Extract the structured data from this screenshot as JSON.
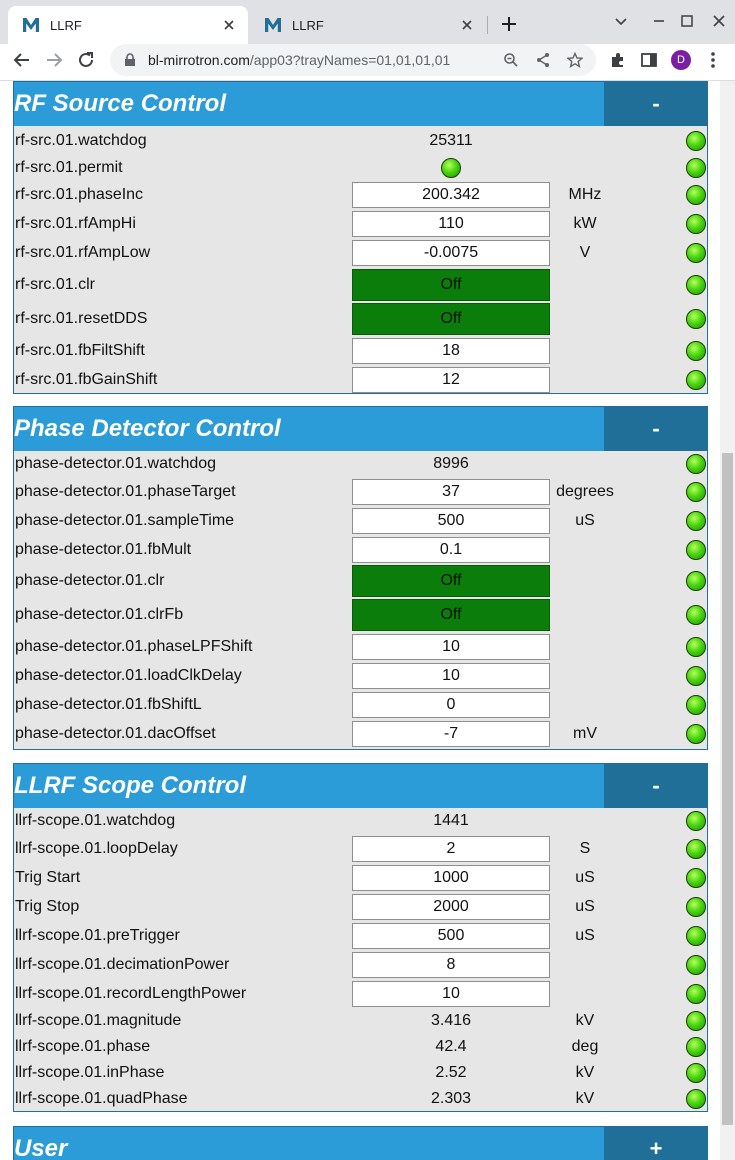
{
  "browser": {
    "tabs": [
      {
        "title": "LLRF",
        "favicon": "M"
      },
      {
        "title": "LLRF",
        "favicon": "M"
      }
    ],
    "url_host": "bl-mirrotron.com",
    "url_path": "/app03?trayNames=01,01,01,01",
    "profile_initial": "D",
    "favicon_color": "#1f6f98",
    "profile_color": "#7b1fa2"
  },
  "panels": {
    "rf": {
      "title": "RF Source Control",
      "toggle": "-",
      "rows": {
        "watchdog": {
          "label": "rf-src.01.watchdog",
          "value": "25311"
        },
        "permit": {
          "label": "rf-src.01.permit"
        },
        "phaseInc": {
          "label": "rf-src.01.phaseInc",
          "value": "200.342",
          "unit": "MHz"
        },
        "rfAmpHi": {
          "label": "rf-src.01.rfAmpHi",
          "value": "110",
          "unit": "kW"
        },
        "rfAmpLow": {
          "label": "rf-src.01.rfAmpLow",
          "value": "-0.0075",
          "unit": "V"
        },
        "clr": {
          "label": "rf-src.01.clr",
          "value": "Off"
        },
        "resetDDS": {
          "label": "rf-src.01.resetDDS",
          "value": "Off"
        },
        "fbFiltShift": {
          "label": "rf-src.01.fbFiltShift",
          "value": "18"
        },
        "fbGainShift": {
          "label": "rf-src.01.fbGainShift",
          "value": "12"
        }
      }
    },
    "pd": {
      "title": "Phase Detector Control",
      "toggle": "-",
      "rows": {
        "watchdog": {
          "label": "phase-detector.01.watchdog",
          "value": "8996"
        },
        "phaseTarget": {
          "label": "phase-detector.01.phaseTarget",
          "value": "37",
          "unit": "degrees"
        },
        "sampleTime": {
          "label": "phase-detector.01.sampleTime",
          "value": "500",
          "unit": "uS"
        },
        "fbMult": {
          "label": "phase-detector.01.fbMult",
          "value": "0.1"
        },
        "clr": {
          "label": "phase-detector.01.clr",
          "value": "Off"
        },
        "clrFb": {
          "label": "phase-detector.01.clrFb",
          "value": "Off"
        },
        "phaseLPFShift": {
          "label": "phase-detector.01.phaseLPFShift",
          "value": "10"
        },
        "loadClkDelay": {
          "label": "phase-detector.01.loadClkDelay",
          "value": "10"
        },
        "fbShiftL": {
          "label": "phase-detector.01.fbShiftL",
          "value": "0"
        },
        "dacOffset": {
          "label": "phase-detector.01.dacOffset",
          "value": "-7",
          "unit": "mV"
        }
      }
    },
    "scope": {
      "title": "LLRF Scope Control",
      "toggle": "-",
      "rows": {
        "watchdog": {
          "label": "llrf-scope.01.watchdog",
          "value": "1441"
        },
        "loopDelay": {
          "label": "llrf-scope.01.loopDelay",
          "value": "2",
          "unit": "S"
        },
        "trigStart": {
          "label": "Trig Start",
          "value": "1000",
          "unit": "uS"
        },
        "trigStop": {
          "label": "Trig Stop",
          "value": "2000",
          "unit": "uS"
        },
        "preTrigger": {
          "label": "llrf-scope.01.preTrigger",
          "value": "500",
          "unit": "uS"
        },
        "decimationPower": {
          "label": "llrf-scope.01.decimationPower",
          "value": "8"
        },
        "recordLengthPower": {
          "label": "llrf-scope.01.recordLengthPower",
          "value": "10"
        },
        "magnitude": {
          "label": "llrf-scope.01.magnitude",
          "value": "3.416",
          "unit": "kV"
        },
        "phase": {
          "label": "llrf-scope.01.phase",
          "value": "42.4",
          "unit": "deg"
        },
        "inPhase": {
          "label": "llrf-scope.01.inPhase",
          "value": "2.52",
          "unit": "kV"
        },
        "quadPhase": {
          "label": "llrf-scope.01.quadPhase",
          "value": "2.303",
          "unit": "kV"
        }
      }
    },
    "user": {
      "title": "User",
      "toggle": "+"
    }
  },
  "colors": {
    "header_bg": "#2b9cd8",
    "toggle_bg": "#1f6f98",
    "panel_bg": "#e6e6e6",
    "button_on": "#0a7d0a",
    "led_green": "#49d612"
  }
}
